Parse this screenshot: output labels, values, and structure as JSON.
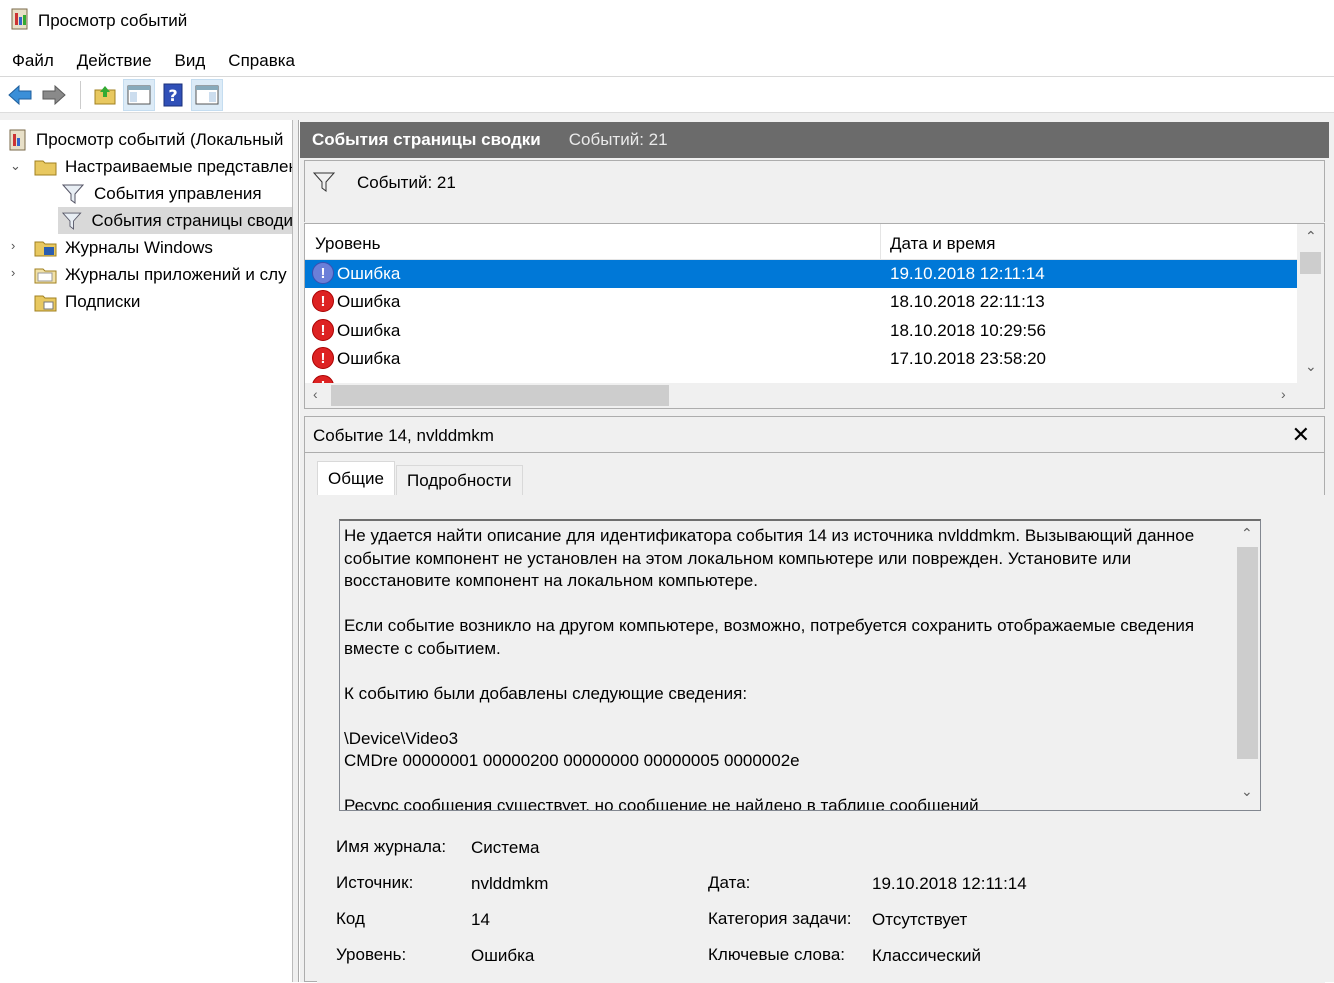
{
  "window": {
    "title": "Просмотр событий"
  },
  "menu": [
    "Файл",
    "Действие",
    "Вид",
    "Справка"
  ],
  "toolbar": {
    "icons": [
      "back-arrow-icon",
      "forward-arrow-icon",
      "folder-up-icon",
      "show-hide-tree-icon",
      "help-icon",
      "show-hide-action-icon"
    ]
  },
  "tree": {
    "root": "Просмотр событий (Локальный",
    "custom_views": "Настраиваемые представлен",
    "admin_events": "События управления",
    "summary_events": "События страницы своди",
    "windows_logs": "Журналы Windows",
    "app_logs": "Журналы приложений и слу",
    "subscriptions": "Подписки"
  },
  "header": {
    "title": "События страницы сводки",
    "count": "Событий: 21"
  },
  "filter": {
    "count": "Событий: 21"
  },
  "grid": {
    "col_level": "Уровень",
    "col_date": "Дата и время",
    "rows": [
      {
        "level": "Ошибка",
        "date": "19.10.2018 12:11:14",
        "selected": true
      },
      {
        "level": "Ошибка",
        "date": "18.10.2018 22:11:13",
        "selected": false
      },
      {
        "level": "Ошибка",
        "date": "18.10.2018 10:29:56",
        "selected": false
      },
      {
        "level": "Ошибка",
        "date": "17.10.2018 23:58:20",
        "selected": false
      }
    ]
  },
  "detail": {
    "title": "Событие 14, nvlddmkm",
    "close": "✕",
    "tab_general": "Общие",
    "tab_details": "Подробности",
    "description": "Не удается найти описание для идентификатора события 14 из источника nvlddmkm. Вызывающий данное событие компонент не установлен на этом локальном компьютере или поврежден. Установите или восстановите компонент на локальном компьютере.\n\nЕсли событие возникло на другом компьютере, возможно, потребуется сохранить отображаемые сведения вместе с событием.\n\nК событию были добавлены следующие сведения:\n\n\\Device\\Video3\nCMDre 00000001 00000200 00000000 00000005 0000002e\n\nРесурс сообщения существует, но сообщение не найдено в таблице сообщений",
    "props": {
      "log_name_label": "Имя журнала:",
      "log_name": "Система",
      "source_label": "Источник:",
      "source": "nvlddmkm",
      "date_label": "Дата:",
      "date": "19.10.2018 12:11:14",
      "code_label": "Код",
      "code": "14",
      "task_label": "Категория задачи:",
      "task": "Отсутствует",
      "level_label": "Уровень:",
      "level": "Ошибка",
      "keywords_label": "Ключевые слова:",
      "keywords": "Классический"
    }
  },
  "colors": {
    "header_bg": "#6b6b6b",
    "selection": "#0078d7",
    "error_red": "#dd2222"
  }
}
